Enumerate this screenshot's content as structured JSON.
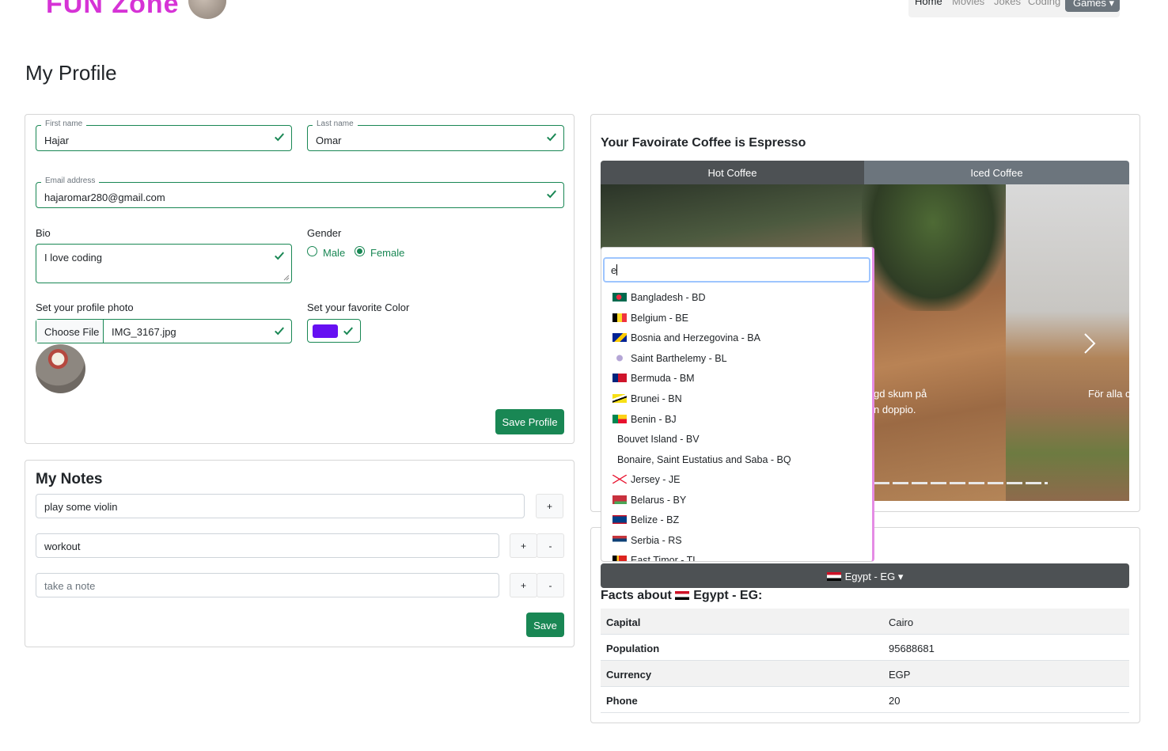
{
  "header": {
    "brand": "FUN Zone",
    "nav": [
      "Home",
      "Movies",
      "Jokes",
      "Coding"
    ],
    "games_label": "Games"
  },
  "page_title": "My Profile",
  "profile": {
    "first_name_label": "First name",
    "first_name": "Hajar",
    "last_name_label": "Last name",
    "last_name": "Omar",
    "email_label": "Email address",
    "email": "hajaromar280@gmail.com",
    "bio_label": "Bio",
    "bio": "I love coding",
    "gender_label": "Gender",
    "gender_options": [
      "Male",
      "Female"
    ],
    "gender_selected": "Female",
    "photo_label": "Set your profile photo",
    "choose_file": "Choose File",
    "file_name": "IMG_3167.jpg",
    "color_label": "Set your favorite Color",
    "favorite_color": "#6610f2",
    "save_label": "Save Profile"
  },
  "notes": {
    "title": "My Notes",
    "items": [
      "play some violin",
      "workout"
    ],
    "placeholder": "take a note",
    "plus": "+",
    "minus": "-",
    "save_label": "Save"
  },
  "coffee": {
    "title": "Your Favoirate Coffee is Espresso",
    "tabs": [
      "Hot Coffee",
      "Iced Coffee"
    ],
    "caption_1a": "gd skum på",
    "caption_1b": "n doppio.",
    "caption_2": "För alla c"
  },
  "country_dropdown": {
    "search_value": "e",
    "options": [
      {
        "label": "Bangladesh - BD",
        "flag": "bd"
      },
      {
        "label": "Belgium - BE",
        "flag": "be"
      },
      {
        "label": "Bosnia and Herzegovina - BA",
        "flag": "ba"
      },
      {
        "label": "Saint Barthelemy - BL",
        "flag": "bl"
      },
      {
        "label": "Bermuda - BM",
        "flag": "bm"
      },
      {
        "label": "Brunei - BN",
        "flag": "bn"
      },
      {
        "label": "Benin - BJ",
        "flag": "bj"
      },
      {
        "label": "Bouvet Island - BV",
        "flag": ""
      },
      {
        "label": "Bonaire, Saint Eustatius and Saba - BQ",
        "flag": ""
      },
      {
        "label": "Jersey - JE",
        "flag": "je"
      },
      {
        "label": "Belarus - BY",
        "flag": "by"
      },
      {
        "label": "Belize - BZ",
        "flag": "bz"
      },
      {
        "label": "Serbia - RS",
        "flag": "rs"
      },
      {
        "label": "East Timor - TL",
        "flag": "tl"
      }
    ],
    "selected": "Egypt - EG"
  },
  "facts": {
    "heading_prefix": "Facts about",
    "heading_country": "Egypt - EG:",
    "rows": [
      {
        "key": "Capital",
        "value": "Cairo"
      },
      {
        "key": "Population",
        "value": "95688681"
      },
      {
        "key": "Currency",
        "value": "EGP"
      },
      {
        "key": "Phone",
        "value": "20"
      }
    ]
  }
}
